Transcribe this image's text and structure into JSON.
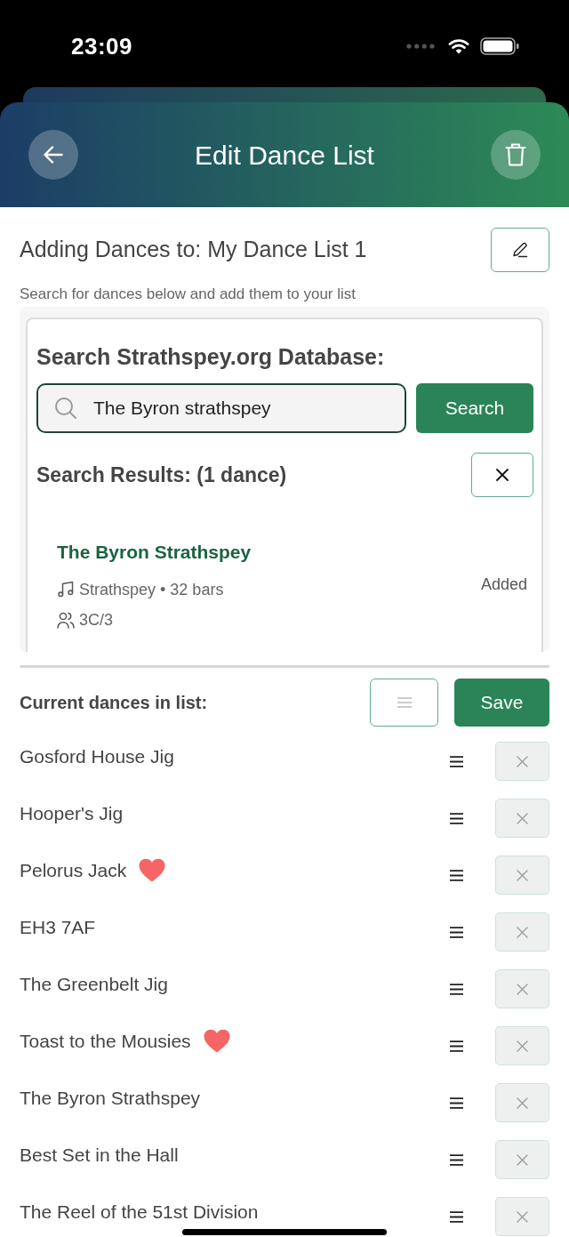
{
  "status_bar": {
    "time": "23:09"
  },
  "header": {
    "title": "Edit Dance List"
  },
  "list_heading": {
    "title": "Adding Dances to: My Dance List 1",
    "subtitle": "Search for dances below and add them to your list"
  },
  "search": {
    "title": "Search Strathspey.org Database:",
    "value": "The Byron strathspey",
    "button": "Search"
  },
  "results": {
    "title": "Search Results: (1 dance)",
    "items": [
      {
        "name": "The Byron Strathspey",
        "meta": "Strathspey • 32 bars",
        "formation": "3C/3",
        "status": "Added"
      }
    ]
  },
  "current": {
    "title": "Current dances in list:",
    "save_button": "Save",
    "dances": [
      {
        "name": "Gosford House Jig",
        "favorite": false
      },
      {
        "name": "Hooper's Jig",
        "favorite": false
      },
      {
        "name": "Pelorus Jack",
        "favorite": true
      },
      {
        "name": "EH3 7AF",
        "favorite": false
      },
      {
        "name": "The Greenbelt Jig",
        "favorite": false
      },
      {
        "name": "Toast to the Mousies",
        "favorite": true
      },
      {
        "name": "The Byron Strathspey",
        "favorite": false
      },
      {
        "name": "Best Set in the Hall",
        "favorite": false
      },
      {
        "name": "The Reel of the 51st Division",
        "favorite": false
      }
    ]
  }
}
